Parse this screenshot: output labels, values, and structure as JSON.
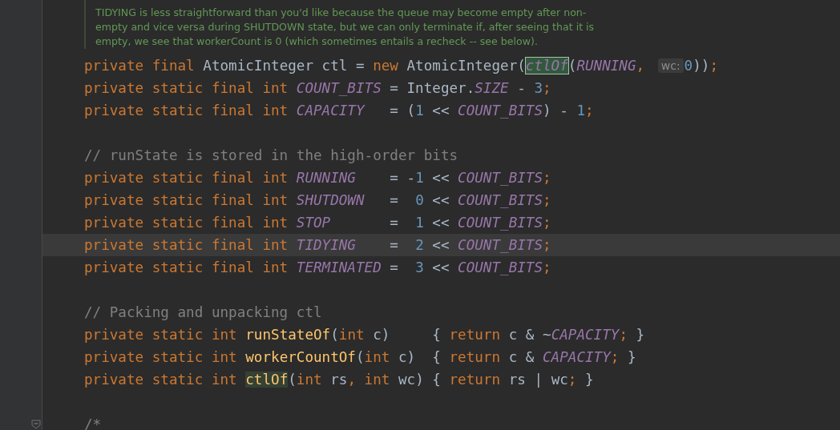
{
  "doc_comment": {
    "lines": [
      "TIDYING is less straightforward than you'd like because the queue may become empty after non-",
      "empty and vice versa during SHUTDOWN state, but we can only terminate if, after seeing that it is",
      "empty, we see that workerCount is 0 (which sometimes entails a recheck -- see below)."
    ]
  },
  "code_lines": [
    {
      "current": false,
      "fold": false,
      "tokens": [
        {
          "kind": "keyword",
          "text": "private final "
        },
        {
          "kind": "plain",
          "text": "AtomicInteger ctl = "
        },
        {
          "kind": "keyword",
          "text": "new "
        },
        {
          "kind": "plain",
          "text": "AtomicInteger("
        },
        {
          "kind": "call_highlight",
          "text": "ctlOf"
        },
        {
          "kind": "plain",
          "text": "("
        },
        {
          "kind": "constant",
          "text": "RUNNING"
        },
        {
          "kind": "keyword",
          "text": ", "
        },
        {
          "kind": "hint",
          "text": "wc:"
        },
        {
          "kind": "number",
          "text": "0"
        },
        {
          "kind": "plain",
          "text": "))"
        },
        {
          "kind": "keyword",
          "text": ";"
        }
      ]
    },
    {
      "current": false,
      "fold": false,
      "tokens": [
        {
          "kind": "keyword",
          "text": "private static final int "
        },
        {
          "kind": "constant",
          "text": "COUNT_BITS"
        },
        {
          "kind": "plain",
          "text": " = Integer."
        },
        {
          "kind": "constant",
          "text": "SIZE"
        },
        {
          "kind": "plain",
          "text": " - "
        },
        {
          "kind": "number",
          "text": "3"
        },
        {
          "kind": "keyword",
          "text": ";"
        }
      ]
    },
    {
      "current": false,
      "fold": false,
      "tokens": [
        {
          "kind": "keyword",
          "text": "private static final int "
        },
        {
          "kind": "constant",
          "text": "CAPACITY"
        },
        {
          "kind": "plain",
          "text": "   = ("
        },
        {
          "kind": "number",
          "text": "1"
        },
        {
          "kind": "plain",
          "text": " << "
        },
        {
          "kind": "constant",
          "text": "COUNT_BITS"
        },
        {
          "kind": "plain",
          "text": ") - "
        },
        {
          "kind": "number",
          "text": "1"
        },
        {
          "kind": "keyword",
          "text": ";"
        }
      ]
    },
    {
      "current": false,
      "fold": false
    },
    {
      "current": false,
      "fold": false,
      "tokens": [
        {
          "kind": "comment",
          "text": "// runState is stored in the high-order bits"
        }
      ]
    },
    {
      "current": false,
      "fold": false,
      "tokens": [
        {
          "kind": "keyword",
          "text": "private static final int "
        },
        {
          "kind": "constant",
          "text": "RUNNING"
        },
        {
          "kind": "plain",
          "text": "    = -"
        },
        {
          "kind": "number",
          "text": "1"
        },
        {
          "kind": "plain",
          "text": " << "
        },
        {
          "kind": "constant",
          "text": "COUNT_BITS"
        },
        {
          "kind": "keyword",
          "text": ";"
        }
      ]
    },
    {
      "current": false,
      "fold": false,
      "tokens": [
        {
          "kind": "keyword",
          "text": "private static final int "
        },
        {
          "kind": "constant",
          "text": "SHUTDOWN"
        },
        {
          "kind": "plain",
          "text": "   =  "
        },
        {
          "kind": "number",
          "text": "0"
        },
        {
          "kind": "plain",
          "text": " << "
        },
        {
          "kind": "constant",
          "text": "COUNT_BITS"
        },
        {
          "kind": "keyword",
          "text": ";"
        }
      ]
    },
    {
      "current": false,
      "fold": false,
      "tokens": [
        {
          "kind": "keyword",
          "text": "private static final int "
        },
        {
          "kind": "constant",
          "text": "STOP"
        },
        {
          "kind": "plain",
          "text": "       =  "
        },
        {
          "kind": "number",
          "text": "1"
        },
        {
          "kind": "plain",
          "text": " << "
        },
        {
          "kind": "constant",
          "text": "COUNT_BITS"
        },
        {
          "kind": "keyword",
          "text": ";"
        }
      ]
    },
    {
      "current": true,
      "fold": false,
      "tokens": [
        {
          "kind": "keyword",
          "text": "private static final int "
        },
        {
          "kind": "constant",
          "text": "TIDYING"
        },
        {
          "kind": "plain",
          "text": "    =  "
        },
        {
          "kind": "number",
          "text": "2"
        },
        {
          "kind": "plain",
          "text": " << "
        },
        {
          "kind": "constant",
          "text": "COUNT_BITS"
        },
        {
          "kind": "keyword",
          "text": ";"
        }
      ]
    },
    {
      "current": false,
      "fold": false,
      "tokens": [
        {
          "kind": "keyword",
          "text": "private static final int "
        },
        {
          "kind": "constant",
          "text": "TERMINATED"
        },
        {
          "kind": "plain",
          "text": " =  "
        },
        {
          "kind": "number",
          "text": "3"
        },
        {
          "kind": "plain",
          "text": " << "
        },
        {
          "kind": "constant",
          "text": "COUNT_BITS"
        },
        {
          "kind": "keyword",
          "text": ";"
        }
      ]
    },
    {
      "current": false,
      "fold": false
    },
    {
      "current": false,
      "fold": false,
      "tokens": [
        {
          "kind": "comment",
          "text": "// Packing and unpacking ctl"
        }
      ]
    },
    {
      "current": false,
      "fold": false,
      "tokens": [
        {
          "kind": "keyword",
          "text": "private static int "
        },
        {
          "kind": "method",
          "text": "runStateOf"
        },
        {
          "kind": "plain",
          "text": "("
        },
        {
          "kind": "keyword",
          "text": "int "
        },
        {
          "kind": "plain",
          "text": "c)     { "
        },
        {
          "kind": "keyword",
          "text": "return "
        },
        {
          "kind": "plain",
          "text": "c & ~"
        },
        {
          "kind": "constant",
          "text": "CAPACITY"
        },
        {
          "kind": "keyword",
          "text": ";"
        },
        {
          "kind": "plain",
          "text": " }"
        }
      ]
    },
    {
      "current": false,
      "fold": false,
      "tokens": [
        {
          "kind": "keyword",
          "text": "private static int "
        },
        {
          "kind": "method",
          "text": "workerCountOf"
        },
        {
          "kind": "plain",
          "text": "("
        },
        {
          "kind": "keyword",
          "text": "int "
        },
        {
          "kind": "plain",
          "text": "c)  { "
        },
        {
          "kind": "keyword",
          "text": "return "
        },
        {
          "kind": "plain",
          "text": "c & "
        },
        {
          "kind": "constant",
          "text": "CAPACITY"
        },
        {
          "kind": "keyword",
          "text": ";"
        },
        {
          "kind": "plain",
          "text": " }"
        }
      ]
    },
    {
      "current": false,
      "fold": false,
      "tokens": [
        {
          "kind": "keyword",
          "text": "private static int "
        },
        {
          "kind": "method_highlight",
          "text": "ctlOf"
        },
        {
          "kind": "plain",
          "text": "("
        },
        {
          "kind": "keyword",
          "text": "int "
        },
        {
          "kind": "plain",
          "text": "rs"
        },
        {
          "kind": "keyword",
          "text": ", int "
        },
        {
          "kind": "plain",
          "text": "wc) { "
        },
        {
          "kind": "keyword",
          "text": "return "
        },
        {
          "kind": "plain",
          "text": "rs | wc"
        },
        {
          "kind": "keyword",
          "text": ";"
        },
        {
          "kind": "plain",
          "text": " }"
        }
      ]
    },
    {
      "current": false,
      "fold": false
    },
    {
      "current": false,
      "fold": true,
      "tokens": [
        {
          "kind": "comment",
          "text": "/*"
        }
      ]
    }
  ]
}
